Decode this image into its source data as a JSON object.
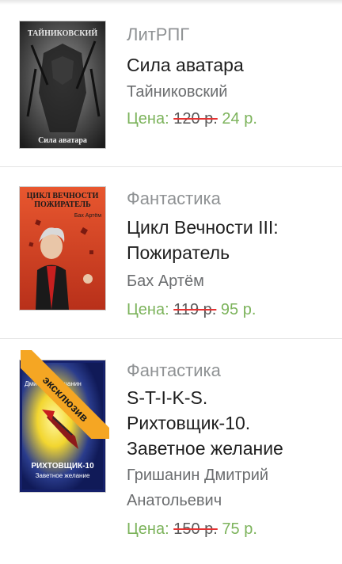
{
  "books": [
    {
      "genre": "ЛитРПГ",
      "title_lines": [
        "Сила аватара"
      ],
      "author_lines": [
        "Тайниковский"
      ],
      "price_label": "Цена:",
      "old_price": "120 р.",
      "new_price": "24 р.",
      "cover_text_top": "ТАЙНИКОВСКИЙ",
      "cover_text_bottom": "Сила аватара"
    },
    {
      "genre": "Фантастика",
      "title_lines": [
        "Цикл Вечности III:",
        "Пожиратель"
      ],
      "author_lines": [
        "Бах Артём"
      ],
      "price_label": "Цена:",
      "old_price": "119 р.",
      "new_price": "95 р.",
      "cover_text_top1": "ЦИКЛ ВЕЧНОСТИ",
      "cover_text_top2": "ПОЖИРАТЕЛЬ",
      "cover_author": "Бах Артём"
    },
    {
      "genre": "Фантастика",
      "title_lines": [
        "S-T-I-K-S.",
        "Рихтовщик-10.",
        "Заветное желание"
      ],
      "author_lines": [
        "Гришанин Дмитрий",
        "Анатольевич"
      ],
      "price_label": "Цена:",
      "old_price": "150 р.",
      "new_price": "75 р.",
      "cover_text_top": "Дмитрий Гришанин",
      "cover_text_title": "РИХТОВЩИК-10",
      "cover_text_sub": "Заветное желание",
      "badge": "эксклюзив"
    }
  ]
}
